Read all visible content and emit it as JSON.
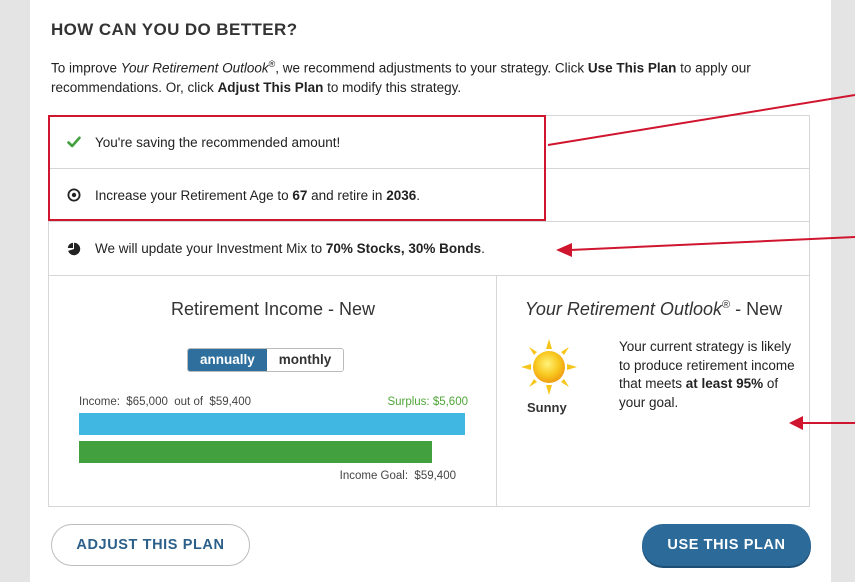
{
  "heading": "HOW CAN YOU DO BETTER?",
  "intro": {
    "part1": "To improve ",
    "product": "Your Retirement Outlook",
    "reg": "®",
    "part2": ", we recommend adjustments to your strategy. Click ",
    "use_label": "Use This Plan",
    "part3": " to apply our recommendations. Or, click ",
    "adjust_label": "Adjust This Plan",
    "part4": " to modify this strategy."
  },
  "recommendations": [
    {
      "icon": "checkmark-icon",
      "text": "You're saving the recommended amount!"
    },
    {
      "icon": "target-icon",
      "text_pre": "Increase your Retirement Age to ",
      "age": "67",
      "text_mid": " and retire in ",
      "year": "2036",
      "text_end": "."
    },
    {
      "icon": "pie-chart-icon",
      "text_pre": "We will update your Investment Mix to ",
      "mix": "70% Stocks, 30% Bonds",
      "text_end": "."
    }
  ],
  "income": {
    "title": "Retirement Income - New",
    "toggle": {
      "annually": "annually",
      "monthly": "monthly",
      "selected": "annually"
    },
    "income_label": "Income:  $65,000  out of  $59,400",
    "surplus_label": "Surplus: $5,600",
    "goal_label": "Income Goal:  $59,400",
    "income_value": 65000,
    "goal_value": 59400,
    "colors": {
      "income": "#3fb7e2",
      "goal": "#43a03f",
      "surplus": "#4fa538"
    }
  },
  "outlook": {
    "title_italic": "Your Retirement Outlook",
    "reg": "®",
    "title_suffix": " - New",
    "weather": "Sunny",
    "text_pre": "Your current strategy is likely to produce retirement income that meets ",
    "text_bold": "at least 95%",
    "text_post": " of your goal."
  },
  "buttons": {
    "adjust": "ADJUST THIS PLAN",
    "use": "USE THIS PLAN"
  },
  "colors": {
    "accent": "#2b6a99",
    "annotation_red": "#d0152e"
  }
}
